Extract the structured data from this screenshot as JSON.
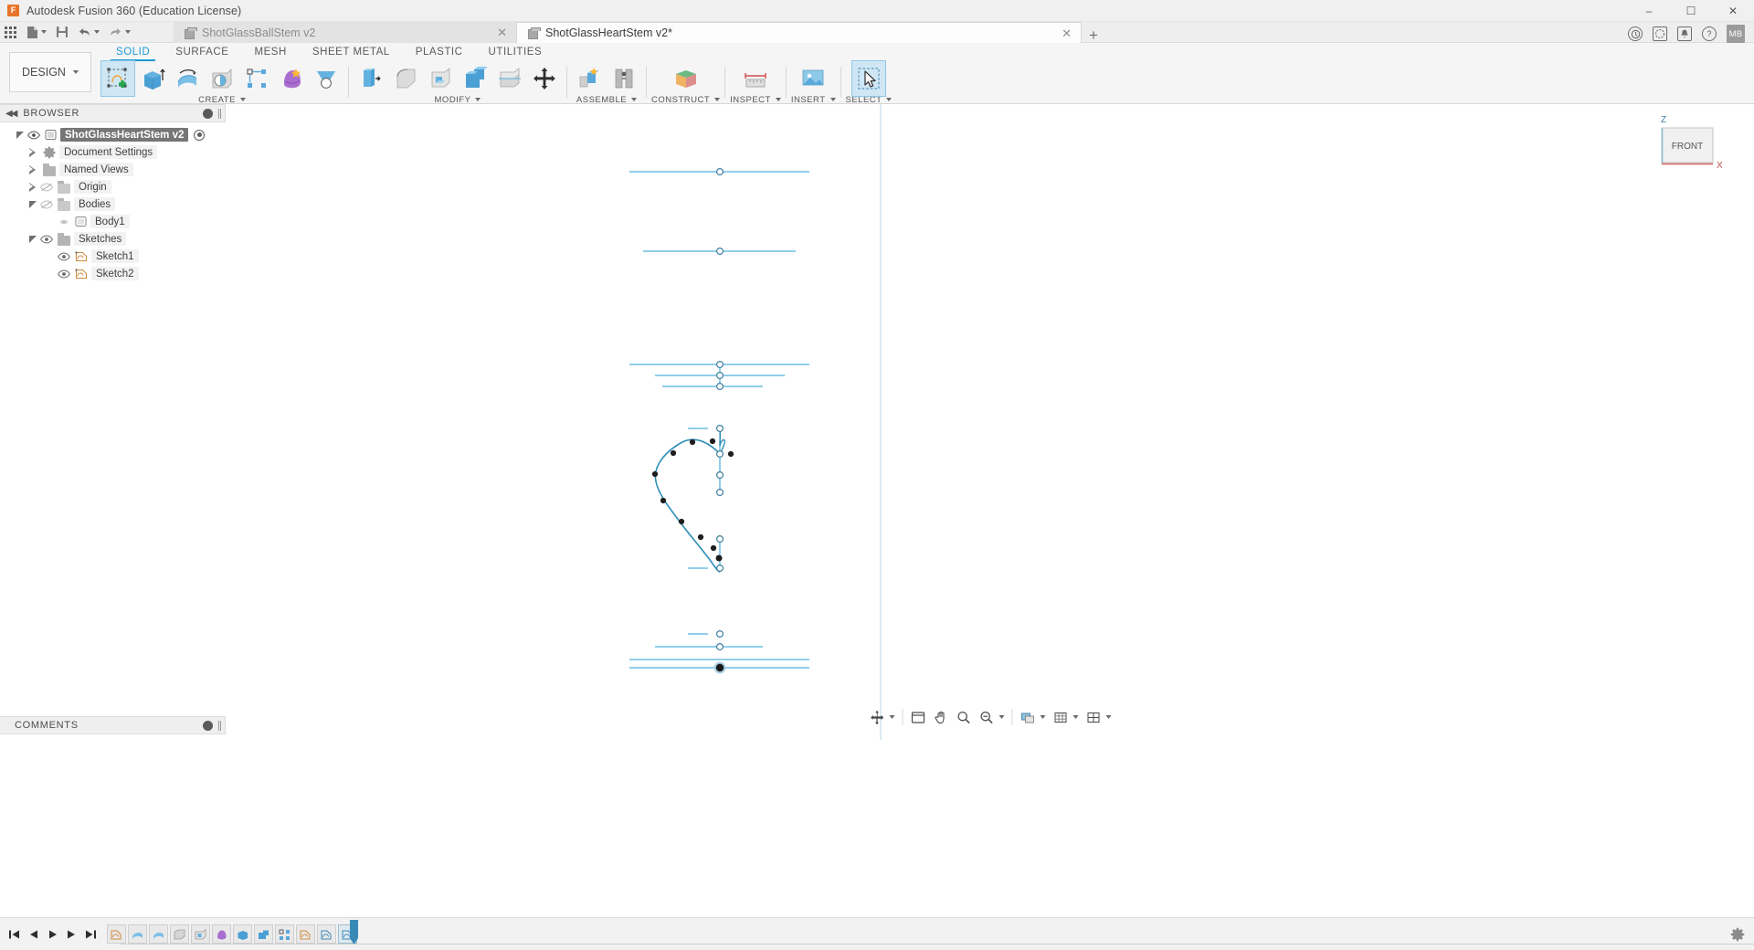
{
  "titlebar": {
    "logo_text": "F",
    "app_title": "Autodesk Fusion 360 (Education License)",
    "minimize": "–",
    "maximize": "☐",
    "close": "✕"
  },
  "quick_access": {
    "apps_grid": "apps-grid-icon",
    "new_file": "new-file-icon",
    "save": "save-icon",
    "undo": "undo-icon",
    "redo": "redo-icon"
  },
  "doc_tabs": [
    {
      "label": "ShotGlassBallStem v2",
      "active": false,
      "close": "✕"
    },
    {
      "label": "ShotGlassHeartStem v2*",
      "active": true,
      "close": "✕"
    }
  ],
  "tab_add": "+",
  "header_icons": {
    "help_globe": "?",
    "extensions": "◌",
    "notifications": "▲",
    "help": "?",
    "avatar_initials": "MB"
  },
  "workspace": {
    "label": "DESIGN",
    "caret": "▾"
  },
  "ribbon_tabs": [
    {
      "label": "SOLID",
      "active": true
    },
    {
      "label": "SURFACE",
      "active": false
    },
    {
      "label": "MESH",
      "active": false
    },
    {
      "label": "SHEET METAL",
      "active": false
    },
    {
      "label": "PLASTIC",
      "active": false
    },
    {
      "label": "UTILITIES",
      "active": false
    }
  ],
  "ribbon_groups": [
    {
      "label": "CREATE",
      "has_caret": true,
      "buttons": [
        {
          "name": "create-sketch-button",
          "selected": true
        },
        {
          "name": "extrude-button",
          "selected": false
        },
        {
          "name": "revolve-button",
          "selected": false
        },
        {
          "name": "hole-button",
          "selected": false
        },
        {
          "name": "pattern-button",
          "selected": false
        },
        {
          "name": "loft-button",
          "selected": false
        },
        {
          "name": "sweep-button",
          "selected": false
        }
      ]
    },
    {
      "label": "MODIFY",
      "has_caret": true,
      "buttons": [
        {
          "name": "press-pull-button",
          "selected": false
        },
        {
          "name": "fillet-button",
          "selected": false
        },
        {
          "name": "shell-button",
          "selected": false
        },
        {
          "name": "combine-button",
          "selected": false
        },
        {
          "name": "split-face-button",
          "selected": false
        },
        {
          "name": "move-copy-button",
          "selected": false
        }
      ]
    },
    {
      "label": "ASSEMBLE",
      "has_caret": true,
      "buttons": [
        {
          "name": "new-component-button",
          "selected": false
        },
        {
          "name": "joint-button",
          "selected": false
        }
      ]
    },
    {
      "label": "CONSTRUCT",
      "has_caret": true,
      "buttons": [
        {
          "name": "offset-plane-button",
          "selected": false
        }
      ]
    },
    {
      "label": "INSPECT",
      "has_caret": true,
      "buttons": [
        {
          "name": "measure-button",
          "selected": false
        }
      ]
    },
    {
      "label": "INSERT",
      "has_caret": true,
      "buttons": [
        {
          "name": "insert-mcmaster-button",
          "selected": false
        }
      ]
    },
    {
      "label": "SELECT",
      "has_caret": true,
      "buttons": [
        {
          "name": "select-tool-button",
          "selected": true
        }
      ]
    }
  ],
  "browser": {
    "header_label": "BROWSER",
    "collapse_icon": "◀◀",
    "tree": [
      {
        "label": "ShotGlassHeartStem v2",
        "indent": 0,
        "expander": "down",
        "eye": "visible",
        "icon": "component-icon",
        "selected": true,
        "radio": true
      },
      {
        "label": "Document Settings",
        "indent": 1,
        "expander": "right",
        "eye": "none",
        "icon": "gear-icon",
        "selected": false,
        "radio": false
      },
      {
        "label": "Named Views",
        "indent": 1,
        "expander": "right",
        "eye": "none",
        "icon": "folder-icon",
        "selected": false,
        "radio": false
      },
      {
        "label": "Origin",
        "indent": 1,
        "expander": "right",
        "eye": "hidden",
        "icon": "folder-icon",
        "selected": false,
        "radio": false
      },
      {
        "label": "Bodies",
        "indent": 1,
        "expander": "down",
        "eye": "hidden",
        "icon": "folder-icon",
        "selected": false,
        "radio": false
      },
      {
        "label": "Body1",
        "indent": 2,
        "expander": "none",
        "eye": "hidden-faint",
        "icon": "body-icon",
        "selected": false,
        "radio": false
      },
      {
        "label": "Sketches",
        "indent": 1,
        "expander": "down",
        "eye": "visible",
        "icon": "folder-icon",
        "selected": false,
        "radio": false
      },
      {
        "label": "Sketch1",
        "indent": 2,
        "expander": "none",
        "eye": "visible",
        "icon": "sketch-icon",
        "selected": false,
        "radio": false
      },
      {
        "label": "Sketch2",
        "indent": 2,
        "expander": "none",
        "eye": "visible",
        "icon": "sketch-icon",
        "selected": false,
        "radio": false
      }
    ]
  },
  "comments": {
    "label": "COMMENTS"
  },
  "viewcube": {
    "face_label": "FRONT",
    "axis_z": "Z",
    "axis_x": "X"
  },
  "navbar": [
    {
      "name": "orbit-button",
      "caret": true
    },
    {
      "name": "look-at-button",
      "caret": false
    },
    {
      "name": "pan-button",
      "caret": false
    },
    {
      "name": "zoom-button",
      "caret": false
    },
    {
      "name": "zoom-window-button",
      "caret": true
    },
    {
      "name": "display-settings-button",
      "caret": true
    },
    {
      "name": "grid-snaps-button",
      "caret": true
    },
    {
      "name": "viewports-button",
      "caret": true
    }
  ],
  "timeline": {
    "playback": [
      {
        "name": "jump-to-beginning-button",
        "glyph": "begin"
      },
      {
        "name": "step-back-button",
        "glyph": "prev"
      },
      {
        "name": "play-button",
        "glyph": "play"
      },
      {
        "name": "step-forward-button",
        "glyph": "next"
      },
      {
        "name": "jump-to-end-button",
        "glyph": "end"
      }
    ],
    "nodes": [
      {
        "name": "timeline-feature-sketch",
        "type": "sketch"
      },
      {
        "name": "timeline-feature-revolve",
        "type": "revolve"
      },
      {
        "name": "timeline-feature-revolve-2",
        "type": "revolve"
      },
      {
        "name": "timeline-feature-fillet",
        "type": "fillet"
      },
      {
        "name": "timeline-feature-shell",
        "type": "shell"
      },
      {
        "name": "timeline-feature-loft",
        "type": "loft"
      },
      {
        "name": "timeline-feature-extrude",
        "type": "extrude"
      },
      {
        "name": "timeline-feature-combine",
        "type": "combine"
      },
      {
        "name": "timeline-feature-pattern",
        "type": "pattern"
      },
      {
        "name": "timeline-feature-sketch-2",
        "type": "sketch"
      },
      {
        "name": "timeline-feature-sketch-3",
        "type": "sketch"
      },
      {
        "name": "timeline-feature-current",
        "type": "current"
      }
    ],
    "settings_icon": "gear-icon"
  },
  "sketch_geometry": {
    "description": "Front view sketch: vertical construction axis with horizontal construction lines and a heart/teardrop spline profile",
    "accent_line_color": "#3aa8d8",
    "spline_color": "#2f8fb8",
    "origin_color": "#1a1a1a",
    "axis_x_color": "#e08888",
    "axis_y_color": "#9ec8dd"
  }
}
